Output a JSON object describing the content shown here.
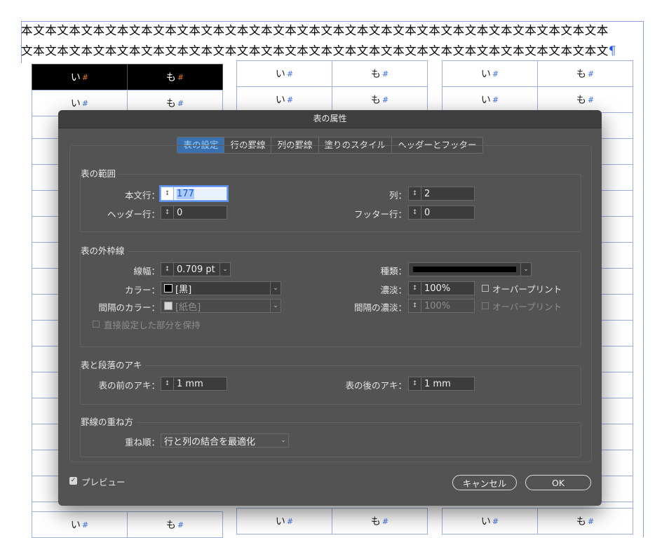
{
  "document": {
    "line1": "本文本文本文本文本文本文本文本文本文本文本文本文本文本文本文本文本文本文本文本文本文本文本文本文本",
    "line2": "文本文本文本文本文本文本文本文本文本文本文本文本文本文本文本文本文本文本文本文本文本文本文本文本文",
    "pilcrow": "¶",
    "cell_a": "い",
    "cell_b": "も",
    "hash": "#"
  },
  "dialog": {
    "title": "表の属性",
    "tabs": [
      "表の設定",
      "行の罫線",
      "列の罫線",
      "塗りのスタイル",
      "ヘッダーとフッター"
    ],
    "active_tab": "表の設定",
    "table_dimensions": {
      "title": "表の範囲",
      "body_rows_label": "本文行：",
      "body_rows_value": "177",
      "header_rows_label": "ヘッダー行：",
      "header_rows_value": "0",
      "columns_label": "列：",
      "columns_value": "2",
      "footer_rows_label": "フッター行：",
      "footer_rows_value": "0"
    },
    "table_border": {
      "title": "表の外枠線",
      "weight_label": "線幅：",
      "weight_value": "0.709 pt",
      "type_label": "種類：",
      "color_label": "カラー：",
      "color_value": "[黒]",
      "tint_label": "濃淡：",
      "tint_value": "100%",
      "overprint_label": "オーバープリント",
      "gap_color_label": "間隔のカラー：",
      "gap_color_value": "[紙色]",
      "gap_tint_label": "間隔の濃淡：",
      "gap_tint_value": "100%",
      "gap_overprint_label": "オーバープリント",
      "preserve_label": "直接設定した部分を保持"
    },
    "table_spacing": {
      "title": "表と段落のアキ",
      "before_label": "表の前のアキ：",
      "before_value": "1 mm",
      "after_label": "表の後のアキ：",
      "after_value": "1 mm"
    },
    "stroke_drawing_order": {
      "title": "罫線の重ね方",
      "draw_label": "重ね順：",
      "draw_value": "行と列の結合を最適化"
    },
    "preview_label": "プレビュー",
    "preview_checked": true,
    "cancel_label": "キャンセル",
    "ok_label": "OK",
    "colors": {
      "dialog_bg": "#535353",
      "active_tab": "#3a6fb0",
      "black_swatch": "#000000",
      "paper_swatch": "#d6d6d6"
    }
  }
}
